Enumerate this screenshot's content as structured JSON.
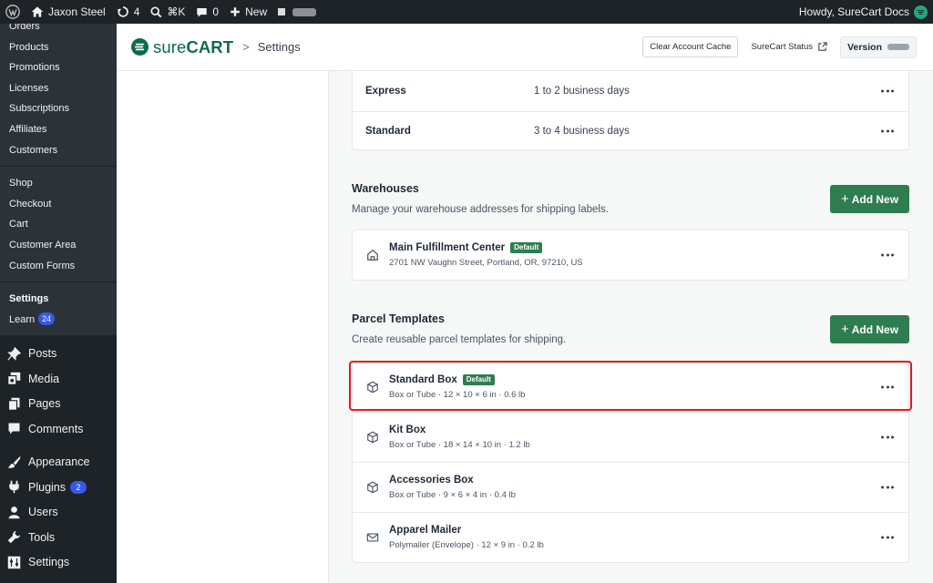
{
  "adminbar": {
    "site_name": "Jaxon Steel",
    "updates_count": "4",
    "shortcut": "⌘K",
    "comments_count": "0",
    "new_label": "New",
    "greeting": "Howdy, SureCart Docs"
  },
  "sidebar": {
    "submenu": {
      "group1": [
        "Orders",
        "Products",
        "Promotions",
        "Licenses",
        "Subscriptions",
        "Affiliates",
        "Customers"
      ],
      "group2": [
        "Shop",
        "Checkout",
        "Cart",
        "Customer Area",
        "Custom Forms"
      ],
      "settings_label": "Settings",
      "learn_label": "Learn",
      "learn_badge": "24"
    },
    "menu": {
      "posts": "Posts",
      "media": "Media",
      "pages": "Pages",
      "comments": "Comments",
      "appearance": "Appearance",
      "plugins": "Plugins",
      "plugins_badge": "2",
      "users": "Users",
      "tools": "Tools",
      "settings": "Settings"
    }
  },
  "header": {
    "logo_light": "sure",
    "logo_bold": "CART",
    "breadcrumb_sep": ">",
    "breadcrumb": "Settings",
    "clear_cache": "Clear Account Cache",
    "status_link": "SureCart Status",
    "version_label": "Version"
  },
  "shipping_rates": [
    {
      "name": "Express",
      "time": "1 to 2 business days"
    },
    {
      "name": "Standard",
      "time": "3 to 4 business days"
    }
  ],
  "warehouses": {
    "title": "Warehouses",
    "description": "Manage your warehouse addresses for shipping labels.",
    "add_label": "Add New",
    "items": [
      {
        "name": "Main Fulfillment Center",
        "badge": "Default",
        "address": "2701 NW Vaughn Street, Portland, OR, 97210, US"
      }
    ]
  },
  "parcels": {
    "title": "Parcel Templates",
    "description": "Create reusable parcel templates for shipping.",
    "add_label": "Add New",
    "items": [
      {
        "name": "Standard Box",
        "badge": "Default",
        "details": "Box or Tube · 12 × 10 × 6 in · 0.6 lb",
        "icon": "box-icon"
      },
      {
        "name": "Kit Box",
        "details": "Box or Tube · 18 × 14 × 10 in · 1.2 lb",
        "icon": "box-icon"
      },
      {
        "name": "Accessories Box",
        "details": "Box or Tube · 9 × 6 × 4 in · 0.4 lb",
        "icon": "box-icon"
      },
      {
        "name": "Apparel Mailer",
        "details": "Polymailer (Envelope) · 12 × 9 in · 0.2 lb",
        "icon": "envelope-icon"
      }
    ]
  },
  "colors": {
    "brand_green": "#2e7d4f",
    "highlight_red": "#e01b1b",
    "admin_dark": "#1d2327",
    "badge_blue": "#3858e9"
  }
}
